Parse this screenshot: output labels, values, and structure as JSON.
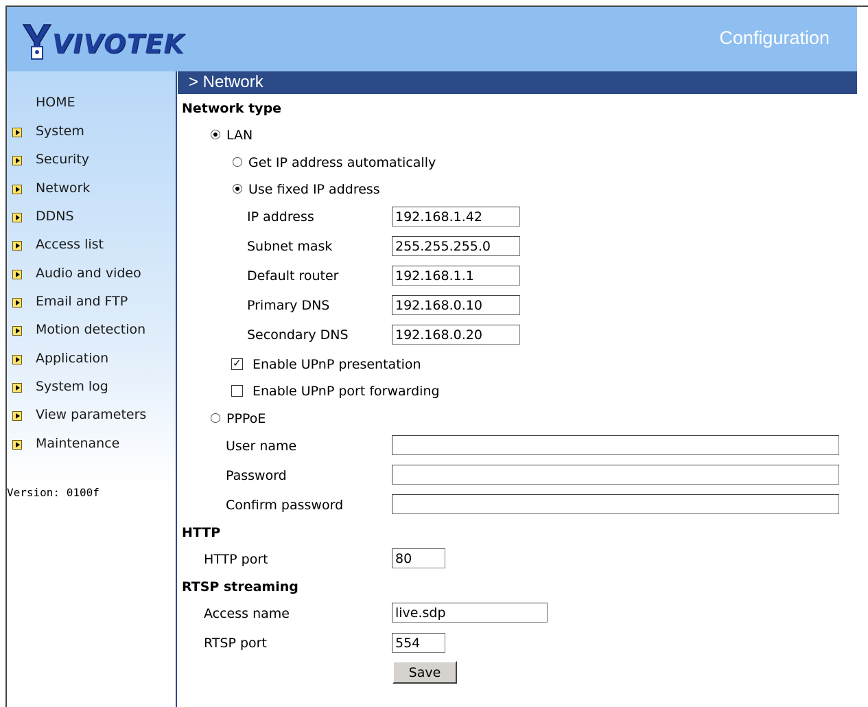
{
  "header": {
    "logo_text": "VIVOTEK",
    "title": "Configuration"
  },
  "sidebar": {
    "home": "HOME",
    "items": [
      {
        "label": "System"
      },
      {
        "label": "Security"
      },
      {
        "label": "Network"
      },
      {
        "label": "DDNS"
      },
      {
        "label": "Access list"
      },
      {
        "label": "Audio and video"
      },
      {
        "label": "Email and FTP"
      },
      {
        "label": "Motion detection"
      },
      {
        "label": "Application"
      },
      {
        "label": "System log"
      },
      {
        "label": "View parameters"
      },
      {
        "label": "Maintenance"
      }
    ],
    "version": "Version: 0100f"
  },
  "page": {
    "breadcrumb": "> Network"
  },
  "network_type": {
    "heading": "Network type",
    "lan_label": "LAN",
    "lan_selected": true,
    "auto_ip_label": "Get IP address automatically",
    "auto_ip_selected": false,
    "fixed_ip_label": "Use fixed IP address",
    "fixed_ip_selected": true,
    "ip_address": {
      "label": "IP address",
      "value": "192.168.1.42"
    },
    "subnet_mask": {
      "label": "Subnet mask",
      "value": "255.255.255.0"
    },
    "default_router": {
      "label": "Default router",
      "value": "192.168.1.1"
    },
    "primary_dns": {
      "label": "Primary DNS",
      "value": "192.168.0.10"
    },
    "secondary_dns": {
      "label": "Secondary DNS",
      "value": "192.168.0.20"
    },
    "upnp_presentation": {
      "label": "Enable UPnP presentation",
      "checked": true
    },
    "upnp_port_forwarding": {
      "label": "Enable UPnP port forwarding",
      "checked": false
    },
    "pppoe_label": "PPPoE",
    "pppoe_selected": false,
    "user_name": {
      "label": "User name",
      "value": ""
    },
    "password": {
      "label": "Password",
      "value": ""
    },
    "confirm_password": {
      "label": "Confirm password",
      "value": ""
    }
  },
  "http": {
    "heading": "HTTP",
    "port_label": "HTTP port",
    "port_value": "80"
  },
  "rtsp": {
    "heading": "RTSP streaming",
    "access_name_label": "Access name",
    "access_name_value": "live.sdp",
    "port_label": "RTSP port",
    "port_value": "554"
  },
  "actions": {
    "save_label": "Save"
  },
  "colors": {
    "header_bg": "#8ebff0",
    "titlebar_bg": "#2b4a87",
    "logo": "#1d3e9a"
  }
}
